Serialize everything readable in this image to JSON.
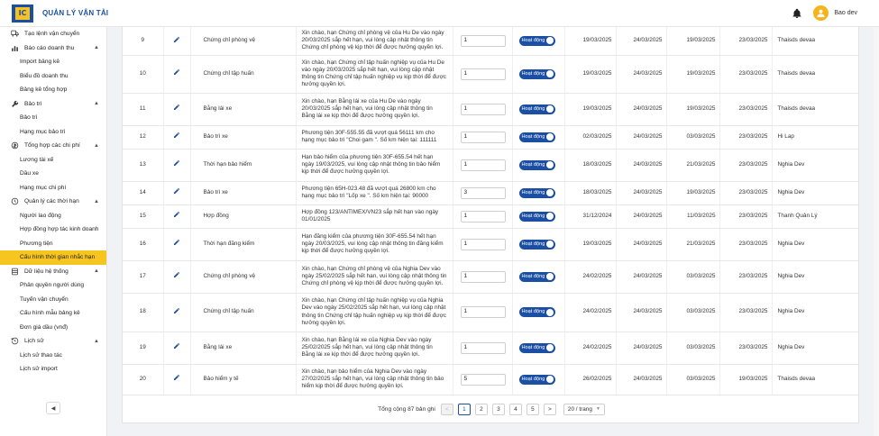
{
  "app": {
    "title": "QUẢN LÝ VẬN TẢI",
    "logo_text": "IC",
    "user": "Bao dev"
  },
  "sidebar": {
    "items": [
      {
        "label": "Tạo lệnh vận chuyển",
        "kind": "group",
        "icon": "truck-icon",
        "chevron": ""
      },
      {
        "label": "Báo cáo doanh thu",
        "kind": "group",
        "icon": "chart-icon",
        "chevron": "▲"
      },
      {
        "label": "Import bảng kê",
        "kind": "sub"
      },
      {
        "label": "Biểu đồ doanh thu",
        "kind": "sub"
      },
      {
        "label": "Bảng kê tổng hợp",
        "kind": "sub"
      },
      {
        "label": "Bảo trì",
        "kind": "group",
        "icon": "wrench-icon",
        "chevron": "▲"
      },
      {
        "label": "Bảo trì",
        "kind": "sub"
      },
      {
        "label": "Hạng mục bảo trì",
        "kind": "sub"
      },
      {
        "label": "Tổng hợp các chi phí",
        "kind": "group",
        "icon": "cost-icon",
        "chevron": "▲"
      },
      {
        "label": "Lương tài xế",
        "kind": "sub"
      },
      {
        "label": "Dầu xe",
        "kind": "sub"
      },
      {
        "label": "Hạng mục chi phí",
        "kind": "sub"
      },
      {
        "label": "Quản lý các thời hạn",
        "kind": "group",
        "icon": "clock-icon",
        "chevron": "▲"
      },
      {
        "label": "Người lao động",
        "kind": "sub"
      },
      {
        "label": "Hợp đồng hợp tác kinh doanh",
        "kind": "sub"
      },
      {
        "label": "Phương tiện",
        "kind": "sub"
      },
      {
        "label": "Cấu hình thời gian nhắc hạn",
        "kind": "sub",
        "active": true
      },
      {
        "label": "Dữ liệu hệ thống",
        "kind": "group",
        "icon": "database-icon",
        "chevron": "▲"
      },
      {
        "label": "Phân quyền người dùng",
        "kind": "sub"
      },
      {
        "label": "Tuyến vận chuyển",
        "kind": "sub"
      },
      {
        "label": "Cấu hình mẫu bảng kê",
        "kind": "sub"
      },
      {
        "label": "Đơn giá dầu (vnđ)",
        "kind": "sub"
      },
      {
        "label": "Lịch sử",
        "kind": "group",
        "icon": "history-icon",
        "chevron": "▲"
      },
      {
        "label": "Lịch sử thao tác",
        "kind": "sub"
      },
      {
        "label": "Lịch sử import",
        "kind": "sub"
      }
    ],
    "collapse_label": "◀"
  },
  "table": {
    "rows": [
      {
        "idx": "9",
        "type": "Chứng chỉ phòng vệ",
        "msg": "Xin chào, hạn Chứng chỉ phòng vệ của Hu De vào ngày 20/03/2025 sắp hết hạn, vui lòng cập nhật thông tin Chứng chỉ phòng vệ kịp thời để được hưởng quyền lợi.",
        "days": "1",
        "status": "Hoạt động",
        "d1": "19/03/2025",
        "d2": "24/03/2025",
        "d3": "19/03/2025",
        "d4": "23/03/2025",
        "user": "Thaisds devaa",
        "h": 31
      },
      {
        "idx": "10",
        "type": "Chứng chỉ tập huấn",
        "msg": "Xin chào, hạn Chứng chỉ tập huấn nghiệp vụ của Hu De vào ngày 20/03/2025 sắp hết hạn, vui lòng cập nhật thông tin Chứng chỉ tập huấn nghiệp vụ kịp thời để được hưởng quyền lợi.",
        "days": "1",
        "status": "Hoạt động",
        "d1": "19/03/2025",
        "d2": "24/03/2025",
        "d3": "19/03/2025",
        "d4": "23/03/2025",
        "user": "Thaisds devaa",
        "h": 42
      },
      {
        "idx": "11",
        "type": "Bằng lái xe",
        "msg": "Xin chào, hạn Bằng lái xe của Hu De vào ngày 20/03/2025 sắp hết hạn, vui lòng cập nhật thông tin Bằng lái xe kịp thời để được hưởng quyền lợi.",
        "days": "1",
        "status": "Hoạt động",
        "d1": "19/03/2025",
        "d2": "24/03/2025",
        "d3": "19/03/2025",
        "d4": "23/03/2025",
        "user": "Thaisds devaa",
        "h": 36
      },
      {
        "idx": "12",
        "type": "Bảo trì xe",
        "msg": "Phương tiện 30F-555.55 đã vượt quá 56111 km cho hạng mục bảo trì \"Choi gam \". Số km hiện tại: 111111",
        "days": "1",
        "status": "Hoạt động",
        "d1": "02/03/2025",
        "d2": "24/03/2025",
        "d3": "03/03/2025",
        "d4": "23/03/2025",
        "user": "Hi Lap",
        "h": 26
      },
      {
        "idx": "13",
        "type": "Thời hạn bảo hiểm",
        "msg": "Hạn bảo hiểm của phương tiện 30F-655.54 hết hạn ngày 19/03/2025, vui lòng cập nhật thông tin bảo hiểm kịp thời để được hưởng quyền lợi.",
        "days": "1",
        "status": "Hoạt động",
        "d1": "18/03/2025",
        "d2": "24/03/2025",
        "d3": "21/03/2025",
        "d4": "23/03/2025",
        "user": "Nghia Dev",
        "h": 36
      },
      {
        "idx": "14",
        "type": "Bảo trì xe",
        "msg": "Phương tiện 65H-023.48 đã vượt quá 26800 km cho hạng mục bảo trì \"Lốp xe \". Số km hiện tại: 90000",
        "days": "3",
        "status": "Hoạt động",
        "d1": "18/03/2025",
        "d2": "24/03/2025",
        "d3": "19/03/2025",
        "d4": "23/03/2025",
        "user": "Nghia Dev",
        "h": 26
      },
      {
        "idx": "15",
        "type": "Hợp đồng",
        "msg": "Hợp đồng 123/ANTIMEX/VN23 sắp hết hạn vào ngày 01/01/2025",
        "days": "1",
        "status": "Hoạt động",
        "d1": "31/12/2024",
        "d2": "24/03/2025",
        "d3": "11/03/2025",
        "d4": "23/03/2025",
        "user": "Thanh Quản Lý",
        "h": 26
      },
      {
        "idx": "16",
        "type": "Thời hạn đăng kiểm",
        "msg": "Hạn đăng kiểm của phương tiện 30F-655.54 hết hạn ngày 20/03/2025, vui lòng cập nhật thông tin đăng kiểm kịp thời để được hưởng quyền lợi.",
        "days": "1",
        "status": "Hoạt động",
        "d1": "19/03/2025",
        "d2": "24/03/2025",
        "d3": "21/03/2025",
        "d4": "23/03/2025",
        "user": "Nghia Dev",
        "h": 36
      },
      {
        "idx": "17",
        "type": "Chứng chỉ phòng vệ",
        "msg": "Xin chào, hạn Chứng chỉ phòng vệ của Nghia Dev vào ngày 25/02/2025 sắp hết hạn, vui lòng cập nhật thông tin Chứng chỉ phòng vệ kịp thời để được hưởng quyền lợi.",
        "days": "1",
        "status": "Hoạt động",
        "d1": "24/02/2025",
        "d2": "24/03/2025",
        "d3": "03/03/2025",
        "d4": "23/03/2025",
        "user": "Nghia Dev",
        "h": 36
      },
      {
        "idx": "18",
        "type": "Chứng chỉ tập huấn",
        "msg": "Xin chào, hạn Chứng chỉ tập huấn nghiệp vụ của Nghia Dev vào ngày 25/02/2025 sắp hết hạn, vui lòng cập nhật thông tin Chứng chỉ tập huấn nghiệp vụ kịp thời để được hưởng quyền lợi.",
        "days": "1",
        "status": "Hoạt động",
        "d1": "24/02/2025",
        "d2": "24/03/2025",
        "d3": "03/03/2025",
        "d4": "23/03/2025",
        "user": "Nghia Dev",
        "h": 43
      },
      {
        "idx": "19",
        "type": "Bằng lái xe",
        "msg": "Xin chào, hạn Bằng lái xe của Nghia Dev vào ngày 25/02/2025 sắp hết hạn, vui lòng cập nhật thông tin Bằng lái xe kịp thời để được hưởng quyền lợi.",
        "days": "1",
        "status": "Hoạt động",
        "d1": "24/02/2025",
        "d2": "24/03/2025",
        "d3": "03/03/2025",
        "d4": "23/03/2025",
        "user": "Nghia Dev",
        "h": 36
      },
      {
        "idx": "20",
        "type": "Bảo hiểm y tế",
        "msg": "Xin chào, hạn bảo hiểm của Nghia Dev vào ngày 27/02/2025 sắp hết hạn, vui lòng cập nhật thông tin bảo hiểm kịp thời để được hưởng quyền lợi.",
        "days": "5",
        "status": "Hoạt động",
        "d1": "26/02/2025",
        "d2": "24/03/2025",
        "d3": "03/03/2025",
        "d4": "19/03/2025",
        "user": "Thaisds devaa",
        "h": 34
      }
    ]
  },
  "pagination": {
    "total_text": "Tổng cộng 87 bản ghi",
    "prev": "<",
    "next": ">",
    "pages": [
      "1",
      "2",
      "3",
      "4",
      "5"
    ],
    "current": "1",
    "page_size": "20 / trang"
  },
  "colors": {
    "brand": "#1a4fa3",
    "accent": "#f7c51f"
  }
}
